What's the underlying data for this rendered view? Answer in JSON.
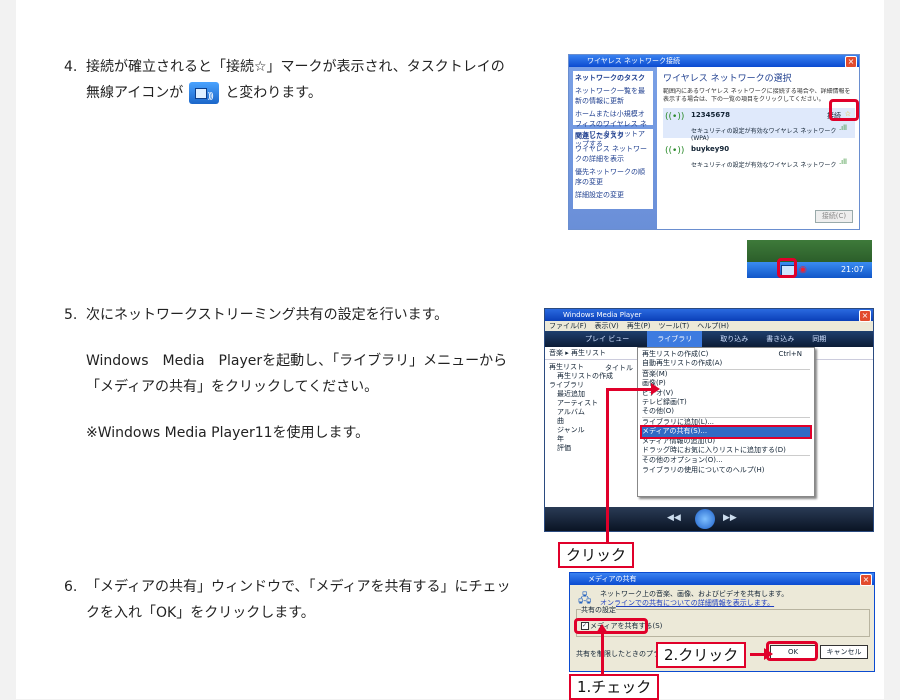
{
  "steps": [
    {
      "num": "4.",
      "line1": "接続が確立されると「接続☆」マークが表示され、タスクトレイの",
      "line2_a": "無線アイコンが",
      "line2_b": "と変わります。"
    },
    {
      "num": "5.",
      "line1": "次にネットワークストリーミング共有の設定を行います。",
      "line2": "Windows　Media　Playerを起動し、「ライブラリ」メニューから",
      "line3": "「メディアの共有」をクリックしてください。",
      "line4": "※Windows Media Player11を使用します。"
    },
    {
      "num": "6.",
      "line1": "「メディアの共有」ウィンドウで、「メディアを共有する」にチェッ",
      "line2": "クを入れ「OK」をクリックします。"
    }
  ],
  "wireless": {
    "title": "ワイヤレス ネットワーク接続",
    "heading": "ワイヤレス ネットワークの選択",
    "side_sections": [
      "ネットワークのタスク",
      "関連したタスク"
    ],
    "side_items": [
      "ネットワーク一覧を最新の情報に更新",
      "ホームまたは小規模オフィスのワイヤレス ネットワークをセットアップする",
      "ワイヤレス ネットワークの詳細を表示",
      "優先ネットワークの順序の変更",
      "詳細設定の変更"
    ],
    "intro": "範囲内にあるワイヤレス ネットワークに接続する場合や、詳細情報を表示する場合は、下の一覧の項目をクリックしてください。",
    "networks": [
      {
        "ssid": "12345678",
        "note": "セキュリティの設定が有効なワイヤレス ネットワーク (WPA)",
        "status": "接続"
      },
      {
        "ssid": "buykey90",
        "note": "セキュリティの設定が有効なワイヤレス ネットワーク",
        "status": ""
      }
    ],
    "connect_btn": "接続(C)",
    "tray_time": "21:07"
  },
  "wmp": {
    "title": "Windows Media Player",
    "menubar": [
      "ファイル(F)",
      "表示(V)",
      "再生(P)",
      "ツール(T)",
      "ヘルプ(H)"
    ],
    "tabs": [
      "プレイ ビュー",
      "ライブラリ",
      "取り込み",
      "書き込み",
      "同期"
    ],
    "breadcrumb": "音楽 ▸ 再生リスト",
    "tree": [
      "再生リスト",
      "再生リストの作成",
      "ライブラリ",
      "最近追加",
      "アーティスト",
      "アルバム",
      "曲",
      "ジャンル",
      "年",
      "評価"
    ],
    "col_header": "タイトル",
    "menu": [
      "再生リストの作成(C)",
      "自動再生リストの作成(A)",
      "音楽(M)",
      "画像(P)",
      "ビデオ(V)",
      "テレビ録画(T)",
      "その他(O)",
      "ライブラリに追加(L)...",
      "メディアの共有(S)...",
      "メディア情報の追加(U)",
      "ドラッグ時にお気に入りリストに追加する(D)",
      "その他のオプション(O)...",
      "ライブラリの使用についてのヘルプ(H)"
    ],
    "shortcut": "Ctrl+N"
  },
  "share": {
    "title": "メディアの共有",
    "desc": "ネットワーク上の音楽、画像、およびビデオを共有します。",
    "link": "オンラインでの共有についての詳細情報を表示します。",
    "group": "共有の設定",
    "checkbox": "メディアを共有する(S)",
    "footer": "共有を制限したときのプライバシー",
    "ok": "OK",
    "cancel": "キャンセル"
  },
  "callouts": {
    "click": "クリック",
    "click2": "2.クリック",
    "check": "1.チェック"
  }
}
